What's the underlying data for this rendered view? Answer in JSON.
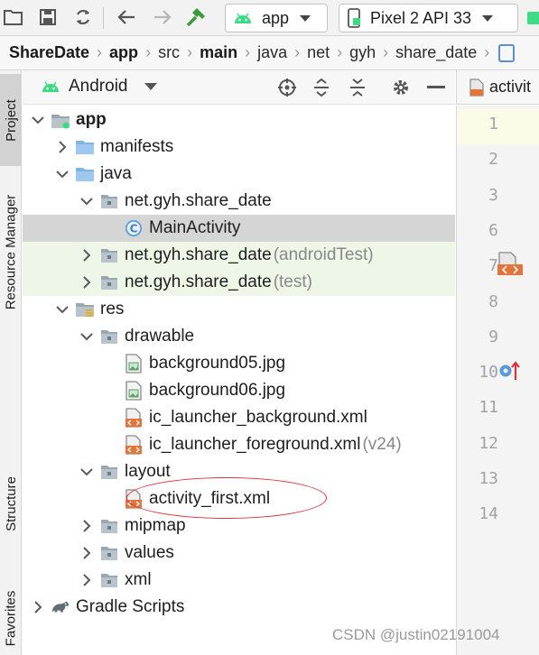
{
  "toolbar": {
    "run_config": "app",
    "device": "Pixel 2 API 33"
  },
  "breadcrumb": [
    "ShareDate",
    "app",
    "src",
    "main",
    "java",
    "net",
    "gyh",
    "share_date"
  ],
  "left_strip": {
    "project": "Project",
    "resource_manager": "Resource Manager",
    "structure": "Structure",
    "favorites": "Favorites"
  },
  "panel": {
    "view_label": "Android"
  },
  "tree": [
    {
      "label": "app",
      "indent": 0,
      "state": "expanded",
      "icon": "app-module-icon",
      "bold": true
    },
    {
      "label": "manifests",
      "indent": 1,
      "state": "collapsed",
      "icon": "folder-icon"
    },
    {
      "label": "java",
      "indent": 1,
      "state": "expanded",
      "icon": "folder-icon"
    },
    {
      "label": "net.gyh.share_date",
      "indent": 2,
      "state": "expanded",
      "icon": "package-icon"
    },
    {
      "label": "MainActivity",
      "indent": 3,
      "state": "leaf",
      "icon": "class-icon",
      "selected": true
    },
    {
      "label": "net.gyh.share_date",
      "suffix": "(androidTest)",
      "indent": 2,
      "state": "collapsed",
      "icon": "package-icon",
      "test": true
    },
    {
      "label": "net.gyh.share_date",
      "suffix": "(test)",
      "indent": 2,
      "state": "collapsed",
      "icon": "package-icon",
      "test": true
    },
    {
      "label": "res",
      "indent": 1,
      "state": "expanded",
      "icon": "res-folder-icon"
    },
    {
      "label": "drawable",
      "indent": 2,
      "state": "expanded",
      "icon": "package-icon"
    },
    {
      "label": "background05.jpg",
      "indent": 3,
      "state": "leaf",
      "icon": "image-file-icon"
    },
    {
      "label": "background06.jpg",
      "indent": 3,
      "state": "leaf",
      "icon": "image-file-icon"
    },
    {
      "label": "ic_launcher_background.xml",
      "indent": 3,
      "state": "leaf",
      "icon": "xml-file-icon"
    },
    {
      "label": "ic_launcher_foreground.xml",
      "suffix": "(v24)",
      "indent": 3,
      "state": "leaf",
      "icon": "xml-file-icon"
    },
    {
      "label": "layout",
      "indent": 2,
      "state": "expanded",
      "icon": "package-icon"
    },
    {
      "label": "activity_first.xml",
      "indent": 3,
      "state": "leaf",
      "icon": "xml-file-icon",
      "highlighted": true
    },
    {
      "label": "mipmap",
      "indent": 2,
      "state": "collapsed",
      "icon": "package-icon"
    },
    {
      "label": "values",
      "indent": 2,
      "state": "collapsed",
      "icon": "package-icon"
    },
    {
      "label": "xml",
      "indent": 2,
      "state": "collapsed",
      "icon": "package-icon"
    },
    {
      "label": "Gradle Scripts",
      "indent": 0,
      "state": "collapsed",
      "icon": "gradle-icon"
    }
  ],
  "editor": {
    "tab_label": "activit",
    "line_numbers": [
      "1",
      "2",
      "3",
      "6",
      "7",
      "8",
      "9",
      "10",
      "11",
      "12",
      "13",
      "14"
    ]
  },
  "watermark": "CSDN @justin02191004",
  "colors": {
    "selection": "#d5d5d5",
    "test_row": "#eef6e8",
    "annotation_circle": "#d9303a",
    "android_green": "#3ddc84"
  }
}
